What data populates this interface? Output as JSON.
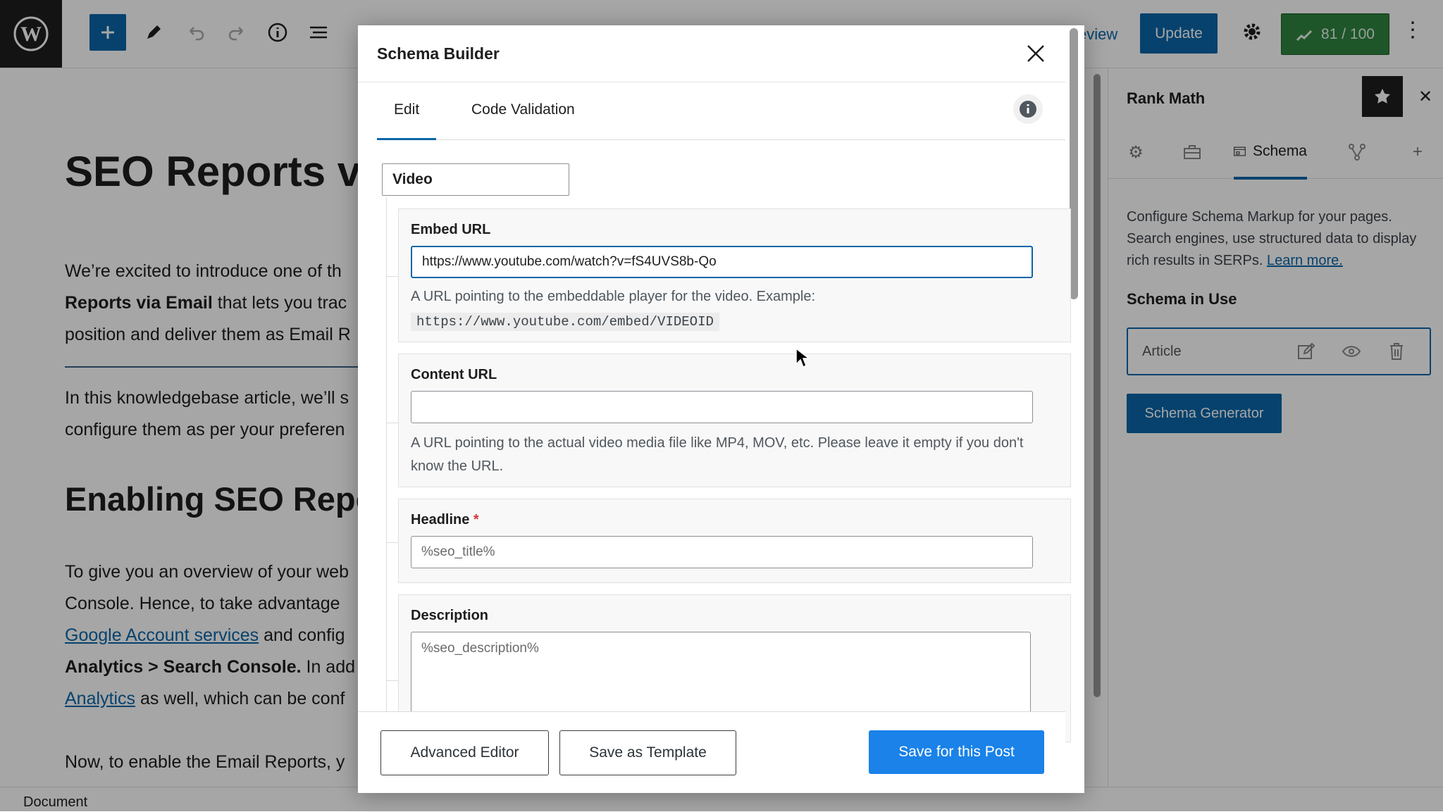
{
  "topbar": {
    "preview_label": "eview",
    "update_label": "Update",
    "score_label": "81 / 100"
  },
  "editor": {
    "title": "SEO Reports v",
    "para1": [
      {
        "pre": "We’re excited to introduce one of th",
        "bold": ""
      },
      {
        "pre": "",
        "bold": "Reports via Email",
        "post": " that lets you trac"
      },
      {
        "pre": "position and deliver them as Email R",
        "bold": ""
      }
    ],
    "para2": [
      "In this knowledgebase article, we’ll s",
      "configure them as per your preferen"
    ],
    "heading2": "Enabling SEO Repo",
    "para3": {
      "line1": "To give you an overview of your web",
      "line2": "Console. Hence, to take advantage",
      "line3_link": "Google Account services",
      "line3_post": " and config",
      "line4_bold": "Analytics > Search Console.",
      "line4_post": " In add",
      "line5_link": "Analytics",
      "line5_post": " as well, which can be conf"
    },
    "para4": "Now, to enable the Email Reports, y"
  },
  "sidebar": {
    "title": "Rank Math",
    "schema_tab": "Schema",
    "description": "Configure Schema Markup for your pages. Search engines, use structured data to display rich results in SERPs.",
    "learn_more": "Learn more.",
    "schema_in_use": "Schema in Use",
    "schema_item": "Article",
    "generator_button": "Schema Generator"
  },
  "statusbar": {
    "label": "Document"
  },
  "modal": {
    "title": "Schema Builder",
    "tabs": [
      "Edit",
      "Code Validation"
    ],
    "schema_type": "Video",
    "fields": {
      "embed_url": {
        "label": "Embed URL",
        "value": "https://www.youtube.com/watch?v=fS4UVS8b-Qo",
        "help": "A URL pointing to the embeddable player for the video. Example:",
        "example": "https://www.youtube.com/embed/VIDEOID"
      },
      "content_url": {
        "label": "Content URL",
        "value": "",
        "help": "A URL pointing to the actual video media file like MP4, MOV, etc. Please leave it empty if you don't know the URL."
      },
      "headline": {
        "label": "Headline",
        "required_mark": "*",
        "value": "%seo_title%"
      },
      "description": {
        "label": "Description",
        "value": "%seo_description%"
      }
    },
    "footer": {
      "advanced_editor": "Advanced Editor",
      "save_template": "Save as Template",
      "save_post": "Save for this Post"
    }
  },
  "colors": {
    "accent": "#0a66a8",
    "primary_button": "#1a82e8",
    "score_green": "#2e8540",
    "required": "#d63638"
  }
}
